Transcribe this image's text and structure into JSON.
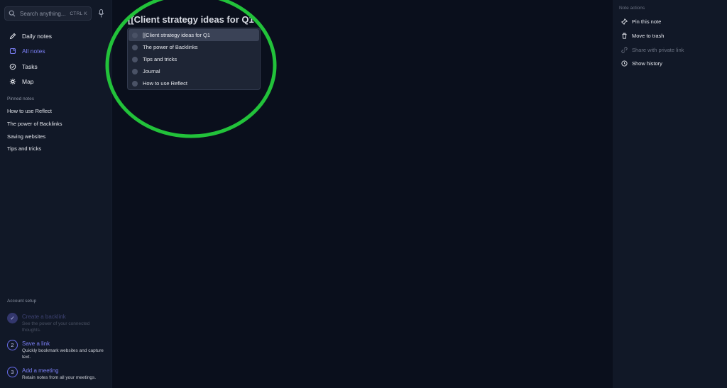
{
  "search": {
    "placeholder": "Search anything...",
    "shortcut": "CTRL K"
  },
  "nav": {
    "items": [
      {
        "label": "Daily notes",
        "icon": "pencil-icon"
      },
      {
        "label": "All notes",
        "icon": "notes-icon",
        "active": true
      },
      {
        "label": "Tasks",
        "icon": "check-circle-icon"
      },
      {
        "label": "Map",
        "icon": "map-network-icon"
      }
    ]
  },
  "pinned": {
    "label": "Pinned notes",
    "items": [
      "How to use Reflect",
      "The power of Backlinks",
      "Saving websites",
      "Tips and tricks"
    ]
  },
  "setup": {
    "label": "Account setup",
    "steps": [
      {
        "number": "✓",
        "title": "Create a backlink",
        "desc": "See the power of your connected thoughts.",
        "completed": true
      },
      {
        "number": "2",
        "title": "Save a link",
        "desc": "Quickly bookmark websites and capture text.",
        "completed": false
      },
      {
        "number": "3",
        "title": "Add a meeting",
        "desc": "Retain notes from all your meetings.",
        "completed": false
      }
    ]
  },
  "editor": {
    "title": "[[Client strategy ideas for Q1"
  },
  "suggestions": [
    "[[Client strategy ideas for Q1",
    "The power of Backlinks",
    "Tips and tricks",
    "Journal",
    "How to use Reflect"
  ],
  "note_actions": {
    "label": "Note actions",
    "items": [
      {
        "label": "Pin this note",
        "icon": "pin-icon"
      },
      {
        "label": "Move to trash",
        "icon": "trash-icon"
      },
      {
        "label": "Share with private link",
        "icon": "link-icon",
        "disabled": true
      },
      {
        "label": "Show history",
        "icon": "clock-icon"
      }
    ]
  },
  "colors": {
    "accent": "#7b7ff5",
    "highlight_ring": "#22c23a",
    "sidebar_bg": "#111827",
    "main_bg": "#0a0f1c"
  }
}
